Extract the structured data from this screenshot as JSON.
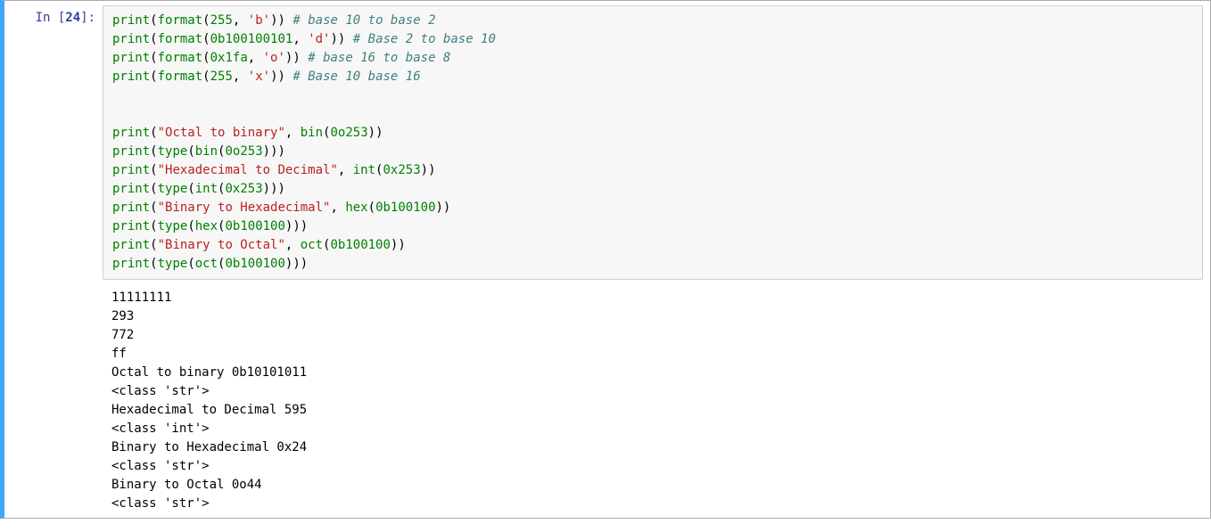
{
  "prompt": {
    "label": "In [",
    "num": "24",
    "close": "]:"
  },
  "code": {
    "l1": {
      "p": "print",
      "f": "format",
      "n": "255",
      "s": "'b'",
      "c": "# base 10 to base 2"
    },
    "l2": {
      "p": "print",
      "f": "format",
      "n": "0b100100101",
      "s": "'d'",
      "c": "# Base 2 to base 10"
    },
    "l3": {
      "p": "print",
      "f": "format",
      "n": "0x1fa",
      "s": "'o'",
      "c": "# base 16 to base 8"
    },
    "l4": {
      "p": "print",
      "f": "format",
      "n": "255",
      "s": "'x'",
      "c": "# Base 10 base 16"
    },
    "l7": {
      "p": "print",
      "s": "\"Octal to binary\"",
      "f": "bin",
      "n": "0o253"
    },
    "l8": {
      "p": "print",
      "t": "type",
      "f": "bin",
      "n": "0o253"
    },
    "l9": {
      "p": "print",
      "s": "\"Hexadecimal to Decimal\"",
      "f": "int",
      "n": "0x253"
    },
    "l10": {
      "p": "print",
      "t": "type",
      "f": "int",
      "n": "0x253"
    },
    "l11": {
      "p": "print",
      "s": "\"Binary to Hexadecimal\"",
      "f": "hex",
      "n": "0b100100"
    },
    "l12": {
      "p": "print",
      "t": "type",
      "f": "hex",
      "n": "0b100100"
    },
    "l13": {
      "p": "print",
      "s": "\"Binary to Octal\"",
      "f": "oct",
      "n": "0b100100"
    },
    "l14": {
      "p": "print",
      "t": "type",
      "f": "oct",
      "n": "0b100100"
    }
  },
  "output": {
    "l1": "11111111",
    "l2": "293",
    "l3": "772",
    "l4": "ff",
    "l5": "Octal to binary 0b10101011",
    "l6": "<class 'str'>",
    "l7": "Hexadecimal to Decimal 595",
    "l8": "<class 'int'>",
    "l9": "Binary to Hexadecimal 0x24",
    "l10": "<class 'str'>",
    "l11": "Binary to Octal 0o44",
    "l12": "<class 'str'>"
  }
}
